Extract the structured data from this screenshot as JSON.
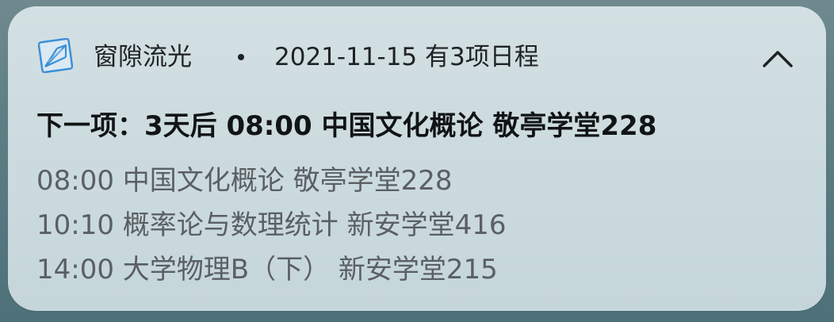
{
  "notification": {
    "app_icon": "app-logo-icon",
    "app_name": "窗隙流光",
    "separator": "•",
    "header_info": "2021-11-15 有3项日程",
    "collapse_icon": "chevron-up-icon",
    "next_title": "下一项：3天后 08:00 中国文化概论 敬亭学堂228",
    "events": [
      "08:00 中国文化概论 敬亭学堂228",
      "10:10 概率论与数理统计 新安学堂416",
      "14:00 大学物理B（下） 新安学堂215"
    ]
  },
  "colors": {
    "card_background": "#cbdade",
    "primary_text": "#111416",
    "secondary_text": "#5a5f63",
    "icon_blue": "#3d8fd6"
  }
}
